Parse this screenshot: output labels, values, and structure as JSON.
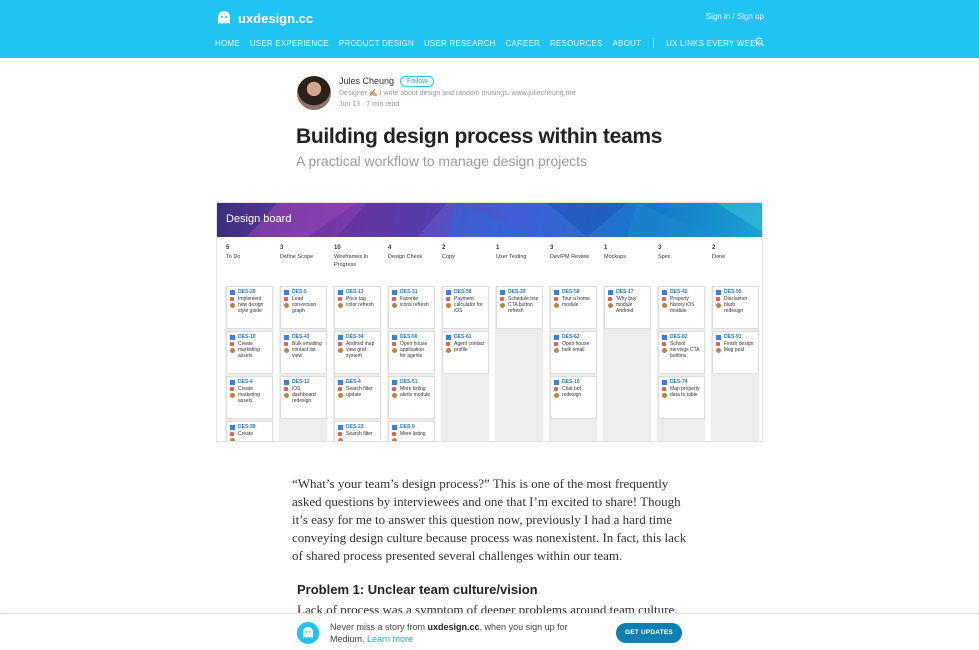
{
  "header": {
    "brand": "uxdesign.cc",
    "auth": "Sign in / Sign up",
    "nav": [
      "HOME",
      "USER EXPERIENCE",
      "PRODUCT DESIGN",
      "USER RESEARCH",
      "CAREER",
      "RESOURCES",
      "ABOUT"
    ],
    "nav_extra": "UX LINKS EVERY WEEK",
    "accent_color": "#1fc4f2"
  },
  "author": {
    "name": "Jules Cheung",
    "follow_label": "Follow",
    "bio": "Designer ✍🏼 I write about design and random musings. www.juliecheung.me",
    "meta": "Jun 13 · 7 min read"
  },
  "article": {
    "title": "Building design process within teams",
    "subtitle": "A practical workflow to manage design projects",
    "para1": "“What’s your team’s design process?” This is one of the most frequently asked questions by interviewees and one that I’m excited to share! Though it’s easy for me to answer this question now, previously I had a hard time conveying design culture because process was nonexistent. In fact, this lack of shared process presented several challenges within our team.",
    "heading1": "Problem 1: Unclear team culture/vision",
    "para2": "Lack of process was a symptom of deeper problems around team culture."
  },
  "board": {
    "title": "Design board",
    "columns": [
      {
        "count": "5",
        "name": "To Do",
        "cards": [
          {
            "id": "DES-29",
            "text": "Implement new design style guide"
          },
          {
            "id": "DES-10",
            "text": "Create marketing assets"
          },
          {
            "id": "DES-4",
            "text": "Create marketing assets"
          },
          {
            "id": "DES-39",
            "text": "Create"
          }
        ]
      },
      {
        "count": "3",
        "name": "Define Scope",
        "cards": [
          {
            "id": "DES-5",
            "text": "Lead conversion graph"
          },
          {
            "id": "DES-43",
            "text": "Bulk emailing contact list view"
          },
          {
            "id": "DES-12",
            "text": "iOS dashboard redesign"
          }
        ]
      },
      {
        "count": "10",
        "name": "Wireframes In Progress",
        "cards": [
          {
            "id": "DES-13",
            "text": "Price tag color refresh"
          },
          {
            "id": "DES-34",
            "text": "Android map view grid system"
          },
          {
            "id": "DES-4",
            "text": "Search filter update"
          },
          {
            "id": "DES-23",
            "text": "Search filter"
          }
        ]
      },
      {
        "count": "4",
        "name": "Design Check",
        "cards": [
          {
            "id": "DES-31",
            "text": "Favorite icons refresh"
          },
          {
            "id": "DES-56",
            "text": "Open house application for agents"
          },
          {
            "id": "DES-51",
            "text": "More listing alerts module"
          },
          {
            "id": "DES-9",
            "text": "More listing"
          }
        ]
      },
      {
        "count": "2",
        "name": "Copy",
        "cards": [
          {
            "id": "DES-58",
            "text": "Payment calculator for iOS"
          },
          {
            "id": "DES-61",
            "text": "Agent contact profile"
          }
        ]
      },
      {
        "count": "1",
        "name": "User Testing",
        "cards": [
          {
            "id": "DES-29",
            "text": "Schedule tour CTA button refresh"
          }
        ]
      },
      {
        "count": "3",
        "name": "Dev/PM Review",
        "cards": [
          {
            "id": "DES-58",
            "text": "Tour a home module"
          },
          {
            "id": "DES-62",
            "text": "Open house bulk email"
          },
          {
            "id": "DES-10",
            "text": "Chat bot redesign"
          }
        ]
      },
      {
        "count": "1",
        "name": "Mockups",
        "cards": [
          {
            "id": "DES-17",
            "text": "'Why buy' module Android"
          }
        ]
      },
      {
        "count": "3",
        "name": "Spec",
        "cards": [
          {
            "id": "DES-42",
            "text": "Property history iOS module"
          },
          {
            "id": "DES-82",
            "text": "School servings CTA buttons"
          },
          {
            "id": "DES-74",
            "text": "Map property data to table"
          }
        ]
      },
      {
        "count": "2",
        "name": "Done",
        "cards": [
          {
            "id": "DES-55",
            "text": "Disclaimer blurb redesign"
          },
          {
            "id": "DES-91",
            "text": "Finish design blog post"
          }
        ]
      }
    ]
  },
  "banner": {
    "text_pre": "Never miss a story from ",
    "text_brand": "uxdesign.cc",
    "text_post": ", when you sign up for Medium. ",
    "learn_more": "Learn more",
    "button": "GET UPDATES"
  }
}
